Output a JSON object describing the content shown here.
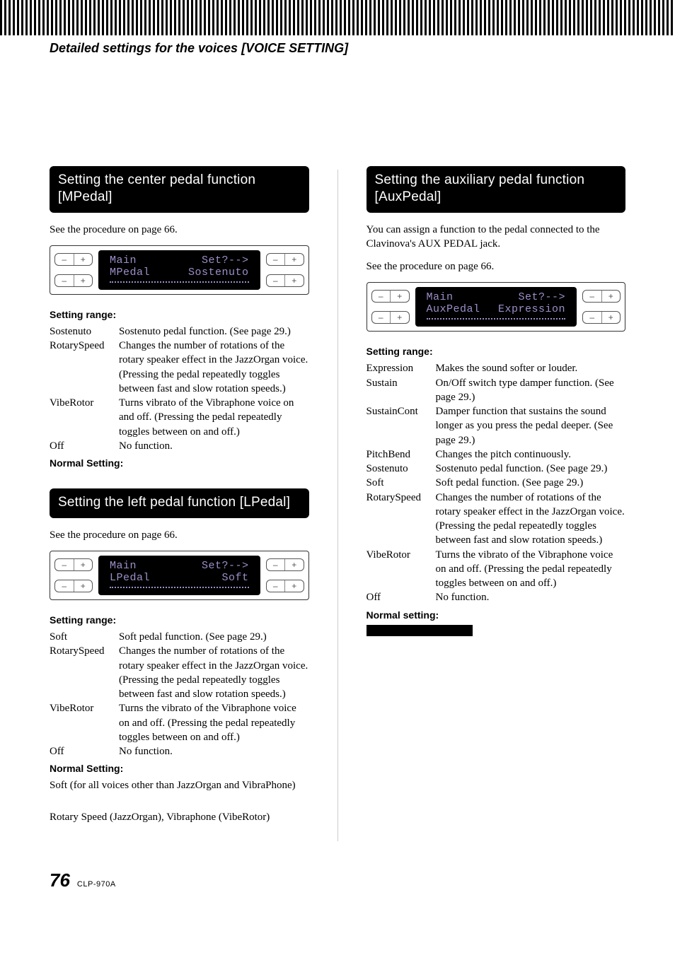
{
  "header": {
    "title": "Detailed settings for the voices [VOICE SETTING]"
  },
  "sections": {
    "mpedal": {
      "heading": "Setting the center pedal function [MPedal]",
      "intro": "See the procedure on page 66.",
      "lcd": {
        "l1a": "Main",
        "l1b": "Set?-->",
        "l2a": "MPedal",
        "l2b": "Sostenuto"
      },
      "range_label": "Setting range:",
      "rows": [
        {
          "k": "Sostenuto",
          "v": "Sostenuto pedal function. (See page 29.)"
        },
        {
          "k": "RotarySpeed",
          "v": "Changes the number of rotations of the rotary speaker effect in the JazzOrgan voice. (Pressing the pedal repeatedly toggles between fast and slow rotation speeds.)"
        },
        {
          "k": "VibeRotor",
          "v": "Turns vibrato of the Vibraphone voice on and off. (Pressing the pedal repeatedly toggles between on and off.)"
        },
        {
          "k": "Off",
          "v": "No function."
        }
      ],
      "normal_label": "Normal Setting:"
    },
    "lpedal": {
      "heading": "Setting the left pedal function [LPedal]",
      "intro": "See the procedure on page 66.",
      "lcd": {
        "l1a": "Main",
        "l1b": "Set?-->",
        "l2a": "LPedal",
        "l2b": "Soft"
      },
      "range_label": "Setting range:",
      "rows": [
        {
          "k": "Soft",
          "v": "Soft pedal function. (See page 29.)"
        },
        {
          "k": "RotarySpeed",
          "v": "Changes the number of rotations of the rotary speaker effect in the JazzOrgan voice. (Pressing the pedal repeatedly toggles between fast and slow rotation speeds.)"
        },
        {
          "k": "VibeRotor",
          "v": "Turns the vibrato of the Vibraphone voice on and off. (Pressing the pedal repeatedly toggles between on and off.)"
        },
        {
          "k": "Off",
          "v": "No function."
        }
      ],
      "normal_label": "Normal Setting:",
      "normal_text1": "Soft (for all voices other than JazzOrgan and VibraPhone)",
      "normal_text2": "Rotary Speed (JazzOrgan), Vibraphone (VibeRotor)"
    },
    "auxpedal": {
      "heading": "Setting the auxiliary pedal function [AuxPedal]",
      "intro1": "You can assign a function to the pedal connected to the Clavinova's AUX PEDAL jack.",
      "intro2": "See the procedure on page 66.",
      "lcd": {
        "l1a": "Main",
        "l1b": "Set?-->",
        "l2a": "AuxPedal",
        "l2b": "Expression"
      },
      "range_label": "Setting range:",
      "rows": [
        {
          "k": "Expression",
          "v": "Makes the sound softer or louder."
        },
        {
          "k": "Sustain",
          "v": "On/Off switch type damper function. (See page 29.)"
        },
        {
          "k": "SustainCont",
          "v": "Damper function that sustains the sound longer as you press the pedal deeper. (See page 29.)"
        },
        {
          "k": "PitchBend",
          "v": "Changes the pitch continuously."
        },
        {
          "k": "Sostenuto",
          "v": "Sostenuto pedal function. (See page 29.)"
        },
        {
          "k": "Soft",
          "v": "Soft pedal function. (See page 29.)"
        },
        {
          "k": "RotarySpeed",
          "v": "Changes the number of rotations of the rotary speaker effect in the JazzOrgan voice. (Pressing the pedal repeatedly toggles between fast and slow rotation speeds.)"
        },
        {
          "k": "VibeRotor",
          "v": "Turns the vibrato of the Vibraphone voice on and off. (Pressing the pedal repeatedly toggles between on and off.)"
        },
        {
          "k": "Off",
          "v": "No function."
        }
      ],
      "normal_label": "Normal setting:"
    }
  },
  "footer": {
    "page": "76",
    "model": "CLP-970A"
  },
  "glyphs": {
    "minus": "–",
    "plus": "+"
  }
}
